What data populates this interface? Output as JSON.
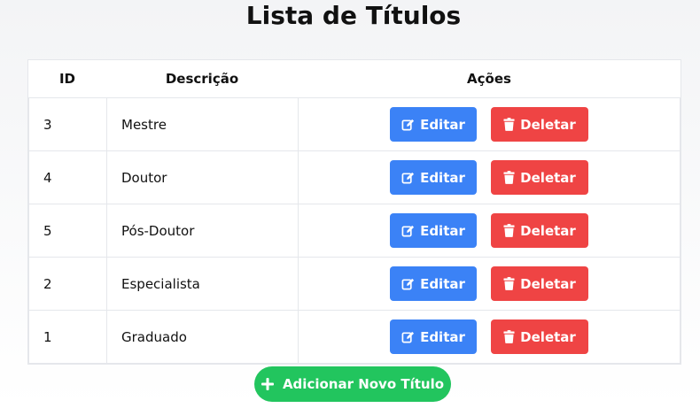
{
  "page": {
    "title": "Lista de Títulos"
  },
  "table": {
    "headers": {
      "id": "ID",
      "descricao": "Descrição",
      "acoes": "Ações"
    },
    "rows": [
      {
        "id": "3",
        "descricao": "Mestre"
      },
      {
        "id": "4",
        "descricao": "Doutor"
      },
      {
        "id": "5",
        "descricao": "Pós-Doutor"
      },
      {
        "id": "2",
        "descricao": "Especialista"
      },
      {
        "id": "1",
        "descricao": "Graduado"
      }
    ],
    "edit_label": "Editar",
    "delete_label": "Deletar"
  },
  "add_button": {
    "label": "Adicionar Novo Título",
    "icon": "plus-icon"
  },
  "colors": {
    "edit": "#3b82f6",
    "delete": "#ef4444",
    "add": "#22c55e"
  }
}
